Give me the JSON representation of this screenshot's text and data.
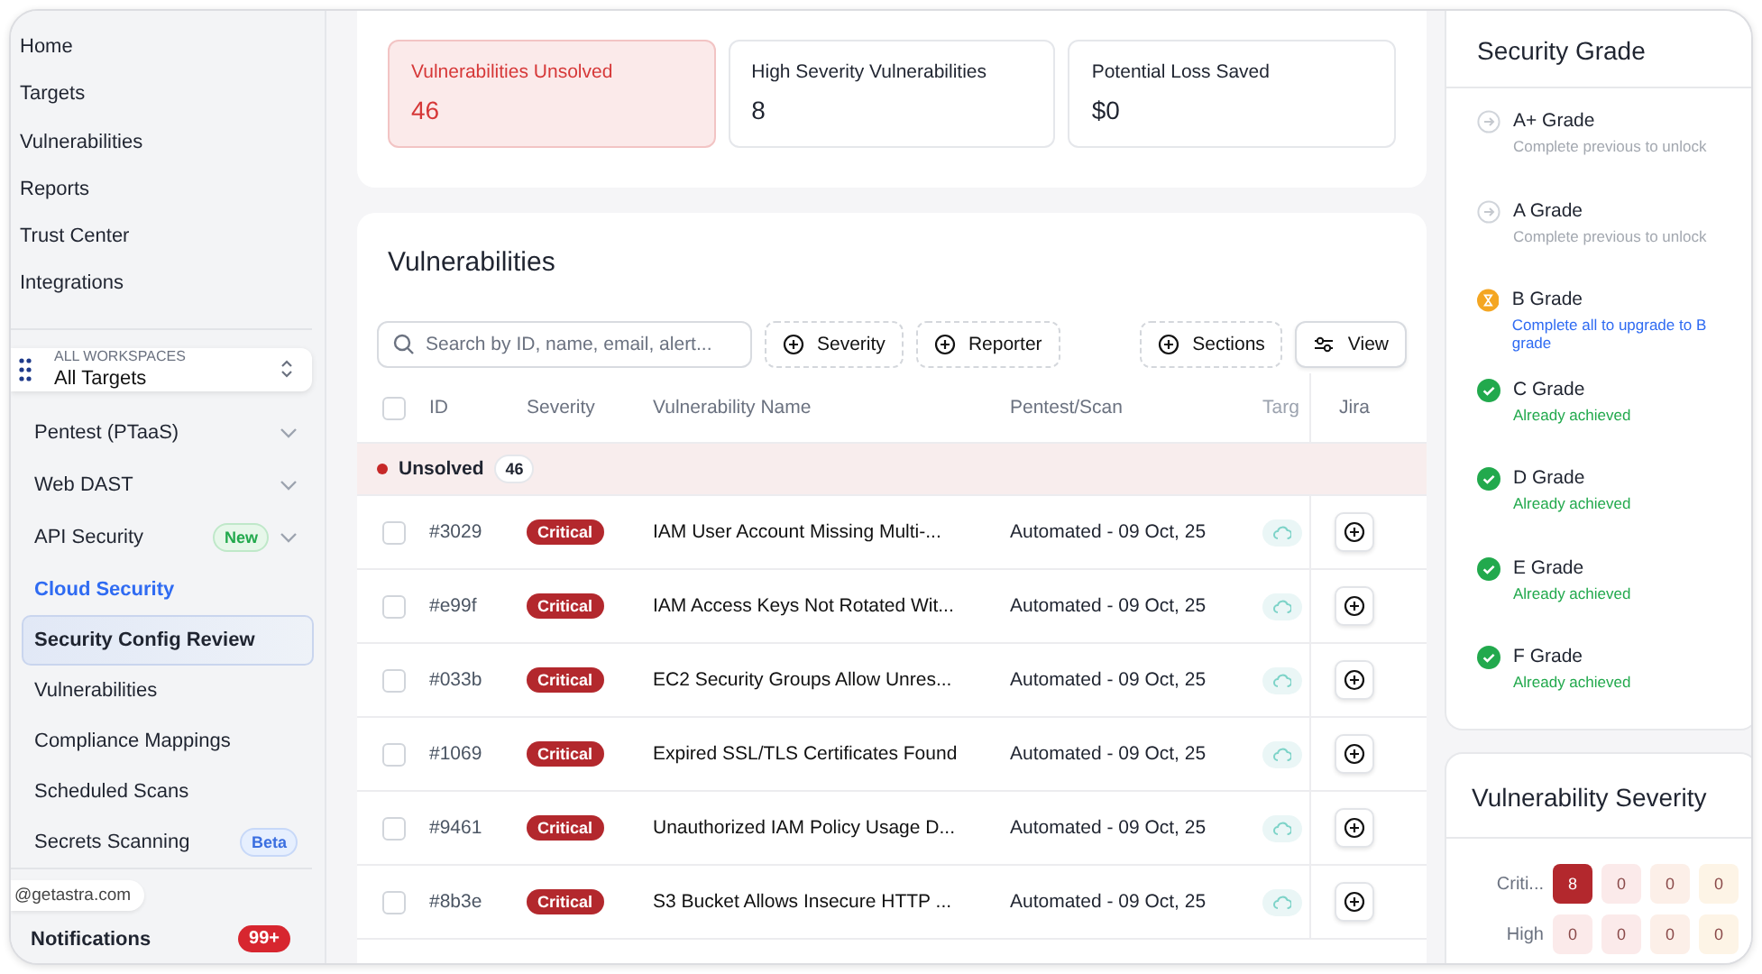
{
  "sidebar": {
    "nav": [
      {
        "label": "Home"
      },
      {
        "label": "Targets"
      },
      {
        "label": "Vulnerabilities"
      },
      {
        "label": "Reports"
      },
      {
        "label": "Trust Center"
      },
      {
        "label": "Integrations"
      }
    ],
    "workspace": {
      "caption": "ALL WORKSPACES",
      "name": "All Targets"
    },
    "items": [
      {
        "label": "Pentest (PTaaS)",
        "kind": "group",
        "selected": false
      },
      {
        "label": "Web DAST",
        "kind": "group",
        "selected": false
      },
      {
        "label": "API Security",
        "kind": "group",
        "badge": "New",
        "selected": false
      },
      {
        "label": "Cloud Security",
        "kind": "heading",
        "selected": false
      },
      {
        "label": "Security Config Review",
        "kind": "sub",
        "selected": true
      },
      {
        "label": "Vulnerabilities",
        "kind": "sub",
        "selected": false
      },
      {
        "label": "Compliance Mappings",
        "kind": "sub",
        "selected": false
      },
      {
        "label": "Scheduled Scans",
        "kind": "sub",
        "selected": false
      },
      {
        "label": "Secrets Scanning",
        "kind": "sub",
        "badge": "Beta",
        "selected": false
      }
    ],
    "email": "@getastra.com",
    "notifications": {
      "label": "Notifications",
      "count": "99+"
    }
  },
  "stats": [
    {
      "label": "Vulnerabilities Unsolved",
      "value": "46",
      "highlighted": true
    },
    {
      "label": "High Severity Vulnerabilities",
      "value": "8",
      "highlighted": false
    },
    {
      "label": "Potential Loss Saved",
      "value": "$0",
      "highlighted": false
    }
  ],
  "vulnerabilities": {
    "title": "Vulnerabilities",
    "search": {
      "placeholder": "Search by ID, name, email, alert..."
    },
    "filters": [
      "Severity",
      "Reporter"
    ],
    "sections_button": "Sections",
    "view_button": "View",
    "select_all_checked": false,
    "columns": [
      "ID",
      "Severity",
      "Vulnerability Name",
      "Pentest/Scan",
      "Targ",
      "Jira"
    ],
    "group": {
      "label": "Unsolved",
      "count": "46"
    },
    "rows": [
      {
        "id": "#3029",
        "severity": "Critical",
        "name": "IAM User Account Missing Multi-...",
        "scan": "Automated - 09 Oct, 25",
        "checked": false
      },
      {
        "id": "#e99f",
        "severity": "Critical",
        "name": "IAM Access Keys Not Rotated Wit...",
        "scan": "Automated - 09 Oct, 25",
        "checked": false
      },
      {
        "id": "#033b",
        "severity": "Critical",
        "name": "EC2 Security Groups Allow Unres...",
        "scan": "Automated - 09 Oct, 25",
        "checked": false
      },
      {
        "id": "#1069",
        "severity": "Critical",
        "name": "Expired SSL/TLS Certificates Found",
        "scan": "Automated - 09 Oct, 25",
        "checked": false
      },
      {
        "id": "#9461",
        "severity": "Critical",
        "name": "Unauthorized IAM Policy Usage D...",
        "scan": "Automated - 09 Oct, 25",
        "checked": false
      },
      {
        "id": "#8b3e",
        "severity": "Critical",
        "name": "S3 Bucket Allows Insecure HTTP ...",
        "scan": "Automated - 09 Oct, 25",
        "checked": false
      }
    ]
  },
  "security_grade": {
    "title": "Security Grade",
    "grades": [
      {
        "name": "A+ Grade",
        "note": "Complete previous to unlock",
        "kind": "locked"
      },
      {
        "name": "A Grade",
        "note": "Complete previous to unlock",
        "kind": "locked"
      },
      {
        "name": "B Grade",
        "note": "Complete all to upgrade to B grade",
        "kind": "pending"
      },
      {
        "name": "C Grade",
        "note": "Already achieved",
        "kind": "achieved"
      },
      {
        "name": "D Grade",
        "note": "Already achieved",
        "kind": "achieved"
      },
      {
        "name": "E Grade",
        "note": "Already achieved",
        "kind": "achieved"
      },
      {
        "name": "F Grade",
        "note": "Already achieved",
        "kind": "achieved"
      }
    ]
  },
  "vulnerability_severity": {
    "title": "Vulnerability Severity",
    "rows": [
      {
        "label": "Criti...",
        "cells": [
          {
            "value": "8",
            "color": "#b3282d"
          },
          {
            "value": "0",
            "color": "#fbeaea"
          },
          {
            "value": "0",
            "color": "#fcefe8"
          },
          {
            "value": "0",
            "color": "#fdf4e6"
          }
        ]
      },
      {
        "label": "High",
        "cells": [
          {
            "value": "0",
            "color": "#fbeaea"
          },
          {
            "value": "0",
            "color": "#fbeaea"
          },
          {
            "value": "0",
            "color": "#fcefe8"
          },
          {
            "value": "0",
            "color": "#fdf4e6"
          }
        ]
      }
    ]
  }
}
